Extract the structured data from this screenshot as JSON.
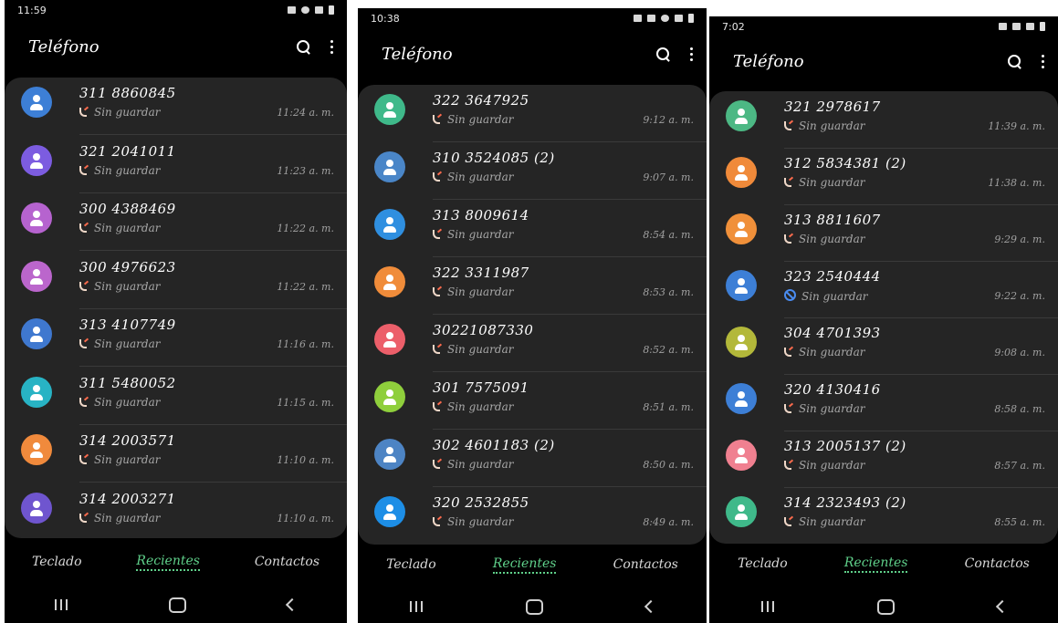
{
  "screens": [
    {
      "status_time": "11:59",
      "title": "Teléfono",
      "calls": [
        {
          "number": "311 8860845",
          "status": "Sin guardar",
          "time": "11:24 a. m.",
          "color": "#3d7fd6",
          "icon": "call-icon"
        },
        {
          "number": "321 2041011",
          "status": "Sin guardar",
          "time": "11:23 a. m.",
          "color": "#7c5ce0",
          "icon": "call-icon"
        },
        {
          "number": "300 4388469",
          "status": "Sin guardar",
          "time": "11:22 a. m.",
          "color": "#b663cf",
          "icon": "call-icon"
        },
        {
          "number": "300 4976623",
          "status": "Sin guardar",
          "time": "11:22 a. m.",
          "color": "#bb66cc",
          "icon": "call-icon"
        },
        {
          "number": "313 4107749",
          "status": "Sin guardar",
          "time": "11:16 a. m.",
          "color": "#3f78cf",
          "icon": "call-icon"
        },
        {
          "number": "311 5480052",
          "status": "Sin guardar",
          "time": "11:15 a. m.",
          "color": "#28b3c4",
          "icon": "call-icon"
        },
        {
          "number": "314 2003571",
          "status": "Sin guardar",
          "time": "11:10 a. m.",
          "color": "#f08a3c",
          "icon": "call-icon"
        },
        {
          "number": "314 2003271",
          "status": "Sin guardar",
          "time": "11:10 a. m.",
          "color": "#6f55cf",
          "icon": "call-icon"
        }
      ],
      "tabs": [
        "Teclado",
        "Recientes",
        "Contactos"
      ]
    },
    {
      "status_time": "10:38",
      "title": "Teléfono",
      "calls": [
        {
          "number": "322 3647925",
          "status": "Sin guardar",
          "time": "9:12 a. m.",
          "color": "#3fb98a",
          "icon": "call-icon"
        },
        {
          "number": "310 3524085 (2)",
          "status": "Sin guardar",
          "time": "9:07 a. m.",
          "color": "#4a86c8",
          "icon": "call-icon"
        },
        {
          "number": "313 8009614",
          "status": "Sin guardar",
          "time": "8:54 a. m.",
          "color": "#2f8fe0",
          "icon": "call-icon"
        },
        {
          "number": "322 3311987",
          "status": "Sin guardar",
          "time": "8:53 a. m.",
          "color": "#f08c3a",
          "icon": "call-icon"
        },
        {
          "number": "30221087330",
          "status": "Sin guardar",
          "time": "8:52 a. m.",
          "color": "#ec5f6a",
          "icon": "call-icon"
        },
        {
          "number": "301 7575091",
          "status": "Sin guardar",
          "time": "8:51 a. m.",
          "color": "#8fcf3c",
          "icon": "call-icon"
        },
        {
          "number": "302 4601183 (2)",
          "status": "Sin guardar",
          "time": "8:50 a. m.",
          "color": "#4d84c4",
          "icon": "call-icon"
        },
        {
          "number": "320 2532855",
          "status": "Sin guardar",
          "time": "8:49 a. m.",
          "color": "#1d8ee6",
          "icon": "call-icon"
        }
      ],
      "tabs": [
        "Teclado",
        "Recientes",
        "Contactos"
      ]
    },
    {
      "status_time": "7:02",
      "title": "Teléfono",
      "calls": [
        {
          "number": "321 2978617",
          "status": "Sin guardar",
          "time": "11:39 a. m.",
          "color": "#4cb884",
          "icon": "call-icon"
        },
        {
          "number": "312 5834381 (2)",
          "status": "Sin guardar",
          "time": "11:38 a. m.",
          "color": "#f08a3a",
          "icon": "call-icon"
        },
        {
          "number": "313 8811607",
          "status": "Sin guardar",
          "time": "9:29 a. m.",
          "color": "#f0903a",
          "icon": "call-icon"
        },
        {
          "number": "323 2540444",
          "status": "Sin guardar",
          "time": "9:22 a. m.",
          "color": "#3d7fd6",
          "icon": "blocked-icon"
        },
        {
          "number": "304 4701393",
          "status": "Sin guardar",
          "time": "9:08 a. m.",
          "color": "#b3b83a",
          "icon": "call-icon"
        },
        {
          "number": "320 4130416",
          "status": "Sin guardar",
          "time": "8:58 a. m.",
          "color": "#3d7fd6",
          "icon": "call-icon"
        },
        {
          "number": "313 2005137 (2)",
          "status": "Sin guardar",
          "time": "8:57 a. m.",
          "color": "#f08090",
          "icon": "call-icon"
        },
        {
          "number": "314 2323493 (2)",
          "status": "Sin guardar",
          "time": "8:55 a. m.",
          "color": "#3fb98a",
          "icon": "call-icon"
        }
      ],
      "tabs": [
        "Teclado",
        "Recientes",
        "Contactos"
      ]
    }
  ],
  "active_tab": "Recientes",
  "accent_color": "#5fd08a"
}
